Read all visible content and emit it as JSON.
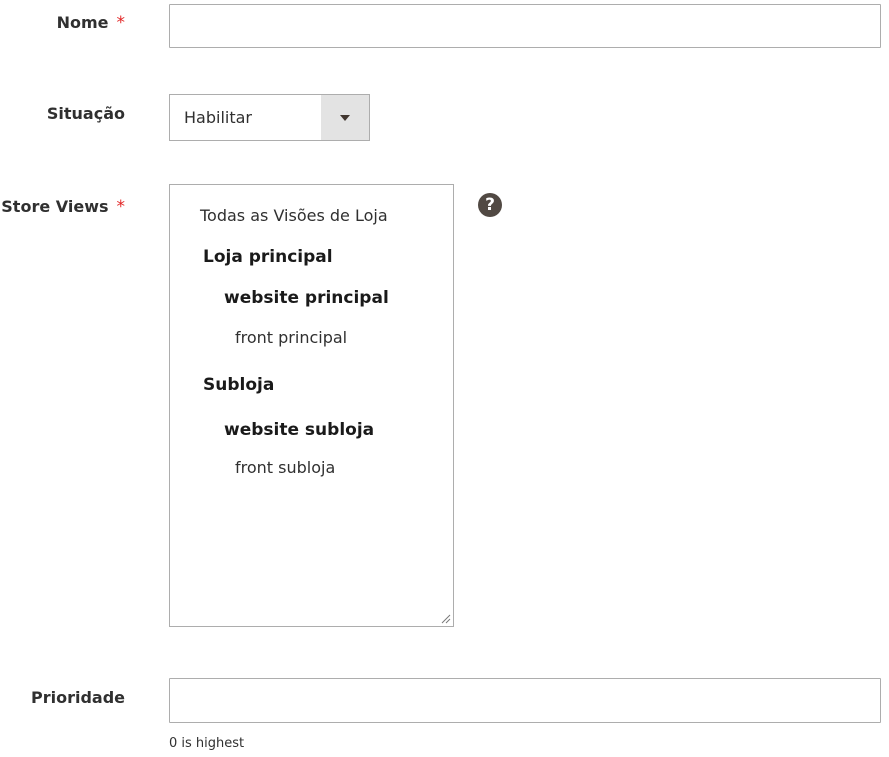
{
  "form": {
    "name": {
      "label": "Nome",
      "required_mark": "*",
      "value": ""
    },
    "status": {
      "label": "Situação",
      "value": "Habilitar"
    },
    "store_views": {
      "label": "Store Views",
      "required_mark": "*",
      "help_icon": "question-circle-icon",
      "help_glyph": "?",
      "options": {
        "all": "Todas as Visões de Loja",
        "store1": "Loja principal",
        "website1": "website principal",
        "view1": "front principal",
        "store2": "Subloja",
        "website2": "website subloja",
        "view2": "front subloja"
      }
    },
    "priority": {
      "label": "Prioridade",
      "value": "",
      "note": "0 is highest"
    }
  },
  "colors": {
    "required": "#e22626",
    "border": "#adadad",
    "select_button": "#e3e3e3",
    "help_icon": "#514943"
  }
}
